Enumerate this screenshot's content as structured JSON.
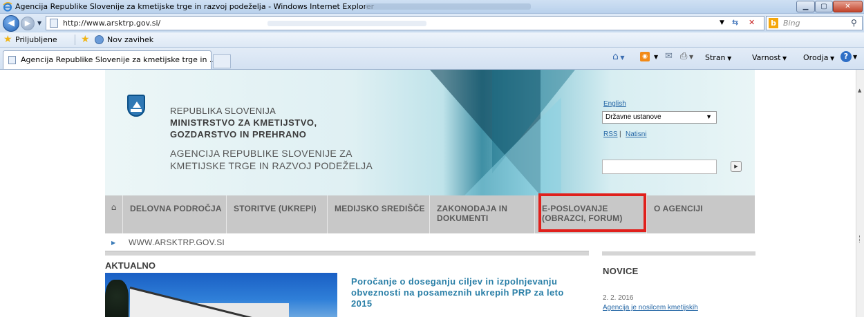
{
  "browser": {
    "window_title": "Agencija Republike Slovenije za kmetijske trge in razvoj podeželja - Windows Internet Explorer",
    "address": "http://www.arsktrp.gov.si/",
    "search_placeholder": "Bing",
    "favorites_label": "Priljubljene",
    "new_tab_label": "Nov zavihek",
    "tab_label": "Agencija Republike Slovenije za kmetijske trge in ...",
    "commands": {
      "page": "Stran",
      "safety": "Varnost",
      "tools": "Orodja"
    },
    "icons": [
      "ie-logo-icon",
      "back-icon",
      "forward-icon",
      "page-icon",
      "refresh-icon",
      "stop-icon",
      "bing-icon",
      "search-icon",
      "star-icon",
      "add-favorite-icon",
      "home-icon",
      "feed-icon",
      "mail-icon",
      "print-icon",
      "help-icon"
    ]
  },
  "site": {
    "header": {
      "org_line1": "REPUBLIKA SLOVENIJA",
      "org_line2": "MINISTRSTVO ZA KMETIJSTVO,",
      "org_line3": "GOZDARSTVO IN PREHRANO",
      "org_line4": "AGENCIJA REPUBLIKE SLOVENIJE ZA",
      "org_line5": "KMETIJSKE TRGE IN RAZVOJ PODEŽELJA",
      "lang_link": "English",
      "institutions_select": "Državne ustanove",
      "rss_link": "RSS",
      "separator": "|",
      "print_link": "Natisni"
    },
    "nav": [
      {
        "label": "DELOVNA PODROČJA"
      },
      {
        "label": "STORITVE (UKREPI)"
      },
      {
        "label": "MEDIJSKO SREDIŠČE"
      },
      {
        "label": "ZAKONODAJA IN\nDOKUMENTI"
      },
      {
        "label": "E-POSLOVANJE\n(OBRAZCI, FORUM)"
      },
      {
        "label": "O AGENCIJI"
      }
    ],
    "highlight_color": "#e0201c",
    "breadcrumb": "WWW.ARSKTRP.GOV.SI",
    "aktualno": {
      "heading": "AKTUALNO",
      "headline": "Poročanje o doseganju ciljev in izpolnjevanju obveznosti na posameznih ukrepih PRP za leto 2015"
    },
    "novice": {
      "heading": "NOVICE",
      "date": "2. 2. 2016",
      "item": "Agencija je nosilcem kmetijskih"
    }
  }
}
